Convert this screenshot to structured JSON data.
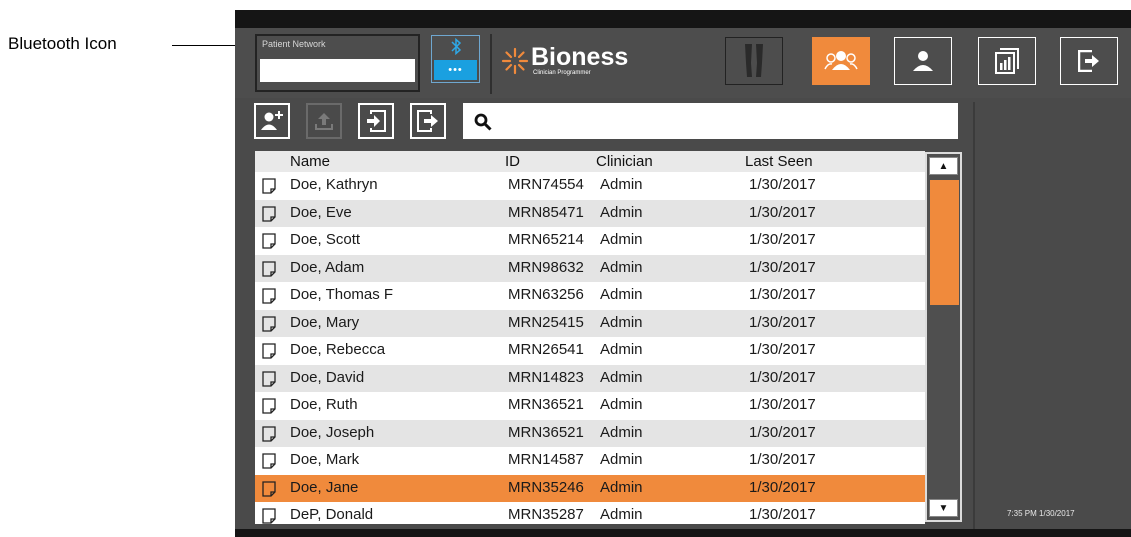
{
  "callout": {
    "label": "Bluetooth Icon"
  },
  "header": {
    "network_label": "Patient Network",
    "network_value": "",
    "bluetooth_symbol": "✱",
    "bluetooth_dots": "•••",
    "logo_name": "Bioness",
    "logo_sub": "Clinician Programmer",
    "buttons": [
      {
        "icon": "legs-icon",
        "active": false
      },
      {
        "icon": "group-icon",
        "active": true
      },
      {
        "icon": "user-icon",
        "active": false
      },
      {
        "icon": "report-icon",
        "active": false
      },
      {
        "icon": "exit-icon",
        "active": false
      }
    ]
  },
  "toolbar": {
    "buttons": [
      {
        "icon": "add-patient-icon",
        "enabled": true
      },
      {
        "icon": "upload-icon",
        "enabled": false
      },
      {
        "icon": "import-icon",
        "enabled": true
      },
      {
        "icon": "export-icon",
        "enabled": true
      }
    ],
    "search_value": "",
    "search_icon": "search-icon"
  },
  "table": {
    "columns": [
      "Name",
      "ID",
      "Clinician",
      "Last Seen"
    ],
    "rows": [
      {
        "name": "Doe, Kathryn",
        "id": "MRN74554",
        "clinician": "Admin",
        "last_seen": "1/30/2017"
      },
      {
        "name": "Doe, Eve",
        "id": "MRN85471",
        "clinician": "Admin",
        "last_seen": "1/30/2017"
      },
      {
        "name": "Doe, Scott",
        "id": "MRN65214",
        "clinician": "Admin",
        "last_seen": "1/30/2017"
      },
      {
        "name": "Doe, Adam",
        "id": "MRN98632",
        "clinician": "Admin",
        "last_seen": "1/30/2017"
      },
      {
        "name": "Doe, Thomas F",
        "id": "MRN63256",
        "clinician": "Admin",
        "last_seen": "1/30/2017"
      },
      {
        "name": "Doe, Mary",
        "id": "MRN25415",
        "clinician": "Admin",
        "last_seen": "1/30/2017"
      },
      {
        "name": "Doe, Rebecca",
        "id": "MRN26541",
        "clinician": "Admin",
        "last_seen": "1/30/2017"
      },
      {
        "name": "Doe, David",
        "id": "MRN14823",
        "clinician": "Admin",
        "last_seen": "1/30/2017"
      },
      {
        "name": "Doe, Ruth",
        "id": "MRN36521",
        "clinician": "Admin",
        "last_seen": "1/30/2017"
      },
      {
        "name": "Doe, Joseph",
        "id": "MRN36521",
        "clinician": "Admin",
        "last_seen": "1/30/2017"
      },
      {
        "name": "Doe, Mark",
        "id": "MRN14587",
        "clinician": "Admin",
        "last_seen": "1/30/2017"
      },
      {
        "name": "Doe, Jane",
        "id": "MRN35246",
        "clinician": "Admin",
        "last_seen": "1/30/2017",
        "selected": true
      },
      {
        "name": "DeP, Donald",
        "id": "MRN35287",
        "clinician": "Admin",
        "last_seen": "1/30/2017"
      }
    ]
  },
  "scrollbar": {
    "up_glyph": "▲",
    "down_glyph": "▼"
  },
  "status": {
    "clock": "7:35 PM 1/30/2017"
  },
  "colors": {
    "accent": "#f08a3c",
    "bluetooth": "#1aa0e0",
    "background": "#4a4a4a"
  }
}
